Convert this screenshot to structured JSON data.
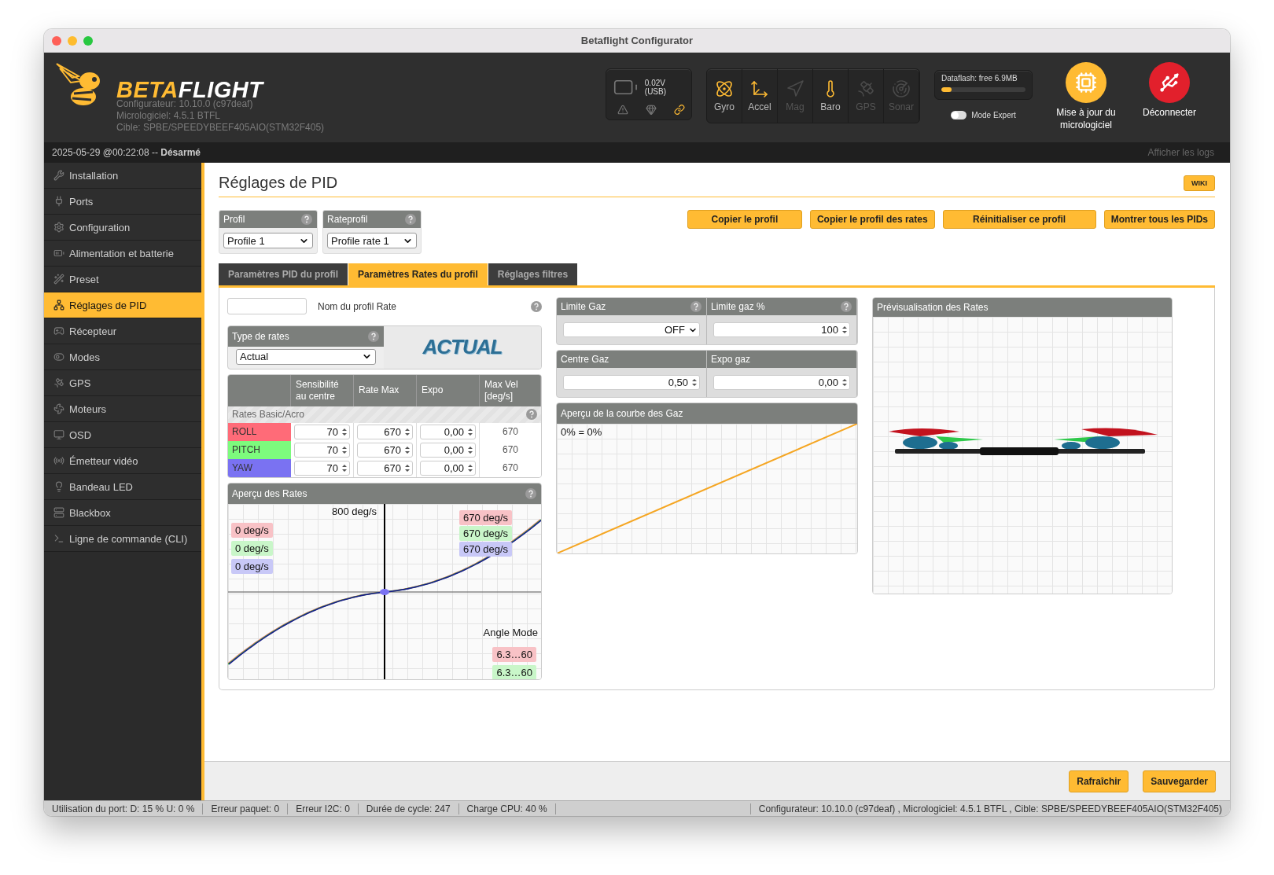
{
  "window": {
    "title": "Betaflight Configurator"
  },
  "header": {
    "logo": {
      "part_1": "BETA",
      "part_2": "FLIGHT"
    },
    "versions": [
      "Configurateur: 10.10.0 (c97deaf)",
      "Micrologiciel: 4.5.1 BTFL",
      "Cible: SPBE/SPEEDYBEEF405AIO(STM32F405)"
    ],
    "battery": {
      "reading": "0.02V (USB)"
    },
    "sensors": [
      {
        "kind": "gyro",
        "label": "Gyro",
        "on": true
      },
      {
        "kind": "accel",
        "label": "Accel",
        "on": true
      },
      {
        "kind": "mag",
        "label": "Mag",
        "on": false
      },
      {
        "kind": "baro",
        "label": "Baro",
        "on": true
      },
      {
        "kind": "gps",
        "label": "GPS",
        "on": false
      },
      {
        "kind": "sonar",
        "label": "Sonar",
        "on": false
      }
    ],
    "dataflash": {
      "label": "Dataflash: free 6.9MB",
      "level": 0.12
    },
    "expert_mode": {
      "label": "Mode Expert",
      "on": false
    },
    "actions": [
      {
        "kind": "firmware",
        "label": "Mise à jour du micrologiciel"
      },
      {
        "kind": "disconnect",
        "label": "Déconnecter"
      }
    ]
  },
  "status_strip": {
    "text": "2025-05-29 @00:22:08 -- **Désarmé**",
    "logs": "Afficher les logs"
  },
  "sidebar": {
    "items": [
      {
        "label": "Installation",
        "selected": false
      },
      {
        "label": "Ports",
        "selected": false
      },
      {
        "label": "Configuration",
        "selected": false
      },
      {
        "label": "Alimentation et batterie",
        "selected": false
      },
      {
        "label": "Preset",
        "selected": false
      },
      {
        "label": "Réglages de PID",
        "selected": true
      },
      {
        "label": "Récepteur",
        "selected": false
      },
      {
        "label": "Modes",
        "selected": false
      },
      {
        "label": "GPS",
        "selected": false
      },
      {
        "label": "Moteurs",
        "selected": false
      },
      {
        "label": "OSD",
        "selected": false
      },
      {
        "label": "Émetteur vidéo",
        "selected": false
      },
      {
        "label": "Bandeau LED",
        "selected": false
      },
      {
        "label": "Blackbox",
        "selected": false
      },
      {
        "label": "Ligne de commande (CLI)",
        "selected": false
      }
    ]
  },
  "page": {
    "title": "Réglages de PID",
    "wiki": "WIKI"
  },
  "profiles": [
    {
      "label": "Profil",
      "value": "Profile 1"
    },
    {
      "label": "Rateprofil",
      "value": "Profile rate 1"
    }
  ],
  "profile_buttons": [
    "Copier le profil",
    "Copier le profil des rates",
    "Réinitialiser ce profil",
    "Montrer tous les PIDs"
  ],
  "tabs": [
    {
      "label": "Paramètres PID du profil",
      "selected": false
    },
    {
      "label": "Paramètres Rates du profil",
      "selected": true
    },
    {
      "label": "Réglages filtres",
      "selected": false
    }
  ],
  "rate_profile_name": {
    "label": "Nom du profil Rate"
  },
  "rates_type": {
    "label": "Type de rates",
    "value": "Actual",
    "logo": "ACTUAL"
  },
  "rates_table": {
    "columns": [
      "Sensibilité au centre",
      "Rate Max",
      "Expo",
      "Max Vel [deg/s]"
    ],
    "section": "Rates Basic/Acro",
    "rows": [
      {
        "axis": "ROLL",
        "color": "#ff6b78",
        "center": "70",
        "max": "670",
        "expo": "0,00",
        "max_vel": "670"
      },
      {
        "axis": "PITCH",
        "color": "#7dfb7d",
        "center": "70",
        "max": "670",
        "expo": "0,00",
        "max_vel": "670"
      },
      {
        "axis": "YAW",
        "color": "#7a72f2",
        "center": "70",
        "max": "670",
        "expo": "0,00",
        "max_vel": "670"
      }
    ]
  },
  "rates_preview": {
    "title": "Aperçu des Rates",
    "top_label": "800 deg/s",
    "current": [
      {
        "reading": "0 deg/s",
        "color": "#f8c2c6"
      },
      {
        "reading": "0 deg/s",
        "color": "#c9f6c9"
      },
      {
        "reading": "0 deg/s",
        "color": "#c8c8f7"
      }
    ],
    "max": [
      {
        "reading": "670 deg/s",
        "color": "#f8c2c6"
      },
      {
        "reading": "670 deg/s",
        "color": "#c9f6c9"
      },
      {
        "reading": "670 deg/s",
        "color": "#c8c8f7"
      }
    ],
    "angle_mode": {
      "label": "Angle Mode",
      "readings": [
        {
          "text": "6.3…60",
          "color": "#f8c2c6"
        },
        {
          "text": "6.3…60",
          "color": "#c9f6c9"
        }
      ]
    }
  },
  "throttle": [
    {
      "kind": "select",
      "label": "Limite Gaz",
      "value": "OFF",
      "help": true
    },
    {
      "kind": "number",
      "label": "Limite gaz %",
      "value": "100",
      "help": true
    },
    {
      "kind": "number",
      "label": "Centre Gaz",
      "value": "0,50",
      "help": false
    },
    {
      "kind": "number",
      "label": "Expo gaz",
      "value": "0,00",
      "help": false
    }
  ],
  "throttle_curve": {
    "title": "Aperçu de la courbe des Gaz",
    "reading": "0% = 0%"
  },
  "rates_3d": {
    "title": "Prévisualisation des Rates"
  },
  "footer_buttons": [
    "Rafraîchir",
    "Sauvegarder"
  ],
  "status_bar": {
    "items": [
      "Utilisation du port: D: 15 % U: 0 %",
      "Erreur paquet: 0",
      "Erreur I2C: 0",
      "Durée de cycle: 247",
      "Charge CPU: 40 %"
    ],
    "version": "Configurateur: 10.10.0 (c97deaf) , Micrologiciel: 4.5.1 BTFL , Cible: SPBE/SPEEDYBEEF405AIO(STM32F405)"
  }
}
